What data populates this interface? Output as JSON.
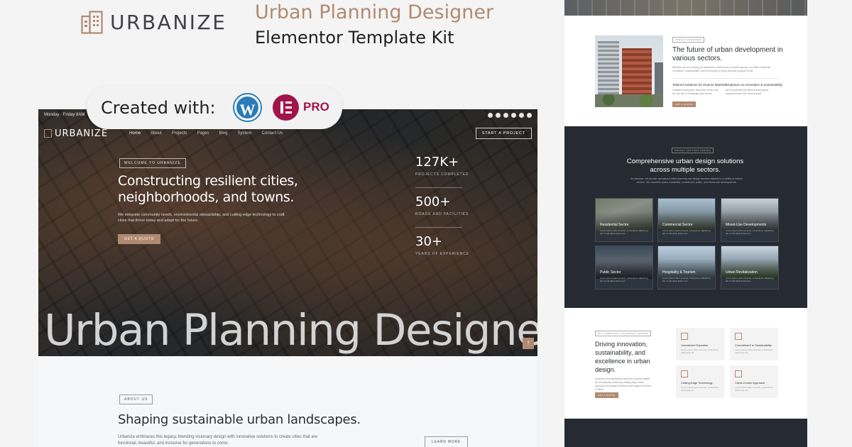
{
  "brand": {
    "logo_text": "URBANIZE",
    "title": "Urban Planning Designer",
    "subtitle": "Elementor Template Kit"
  },
  "badge": {
    "created_with": "Created with:",
    "wordpress_glyph": "W",
    "pro_label": "PRO",
    "icons": [
      "wordpress-icon",
      "elementor-icon"
    ]
  },
  "colors": {
    "accent": "#b08a70",
    "dark": "#262b33",
    "wordpress": "#2b7bb9",
    "elementor": "#a3134b"
  },
  "main": {
    "topbar": {
      "hours": "Monday - Friday 8AM",
      "social_icons": [
        "facebook-icon",
        "youtube-icon",
        "instagram-icon",
        "pinterest-icon",
        "x-icon",
        "linkedin-icon"
      ]
    },
    "nav": {
      "logo": "URBANIZE",
      "links": [
        "Home",
        "About",
        "Projects",
        "Pages",
        "Blog",
        "System",
        "Contact Us"
      ],
      "cta": "START A PROJECT"
    },
    "hero": {
      "tag": "WELCOME TO URBANIZE",
      "heading": "Constructing resilient cities, neighborhoods, and towns.",
      "text": "We integrate community needs, environmental stewardship, and cutting-edge technology to craft cities that thrive today and adapt for the future.",
      "button": "GET A QUOTE",
      "stats": [
        {
          "value": "127K+",
          "label": "PROJECTS COMPLETED"
        },
        {
          "value": "500+",
          "label": "ROADS AND FACILITIES"
        },
        {
          "value": "30+",
          "label": "YEARS OF EXPERIENCE"
        }
      ],
      "big_title": "Urban Planning Designer.",
      "scroll_glyph": "↑"
    },
    "about": {
      "tag": "ABOUT US",
      "heading": "Shaping sustainable urban landscapes.",
      "text": "Urbanize embraces this legacy, blending visionary design with innovative solutions to create cities that are functional, beautiful, and inclusive for generations to come.",
      "button": "LEARN MORE"
    }
  },
  "right": {
    "overview": {
      "tag": "INSIGHT OVERVIEW",
      "heading": "The future of urban development in various sectors.",
      "text": "Whether we are working on residential, commercial, or public spaces, our team combines innovation, sustainability, and technology to bring visionary projects to life.",
      "points": [
        {
          "title": "Tailored Solutions for Diverse Markets",
          "text": "Urbanize recognizes that each sector has its own set of challenges and needs."
        },
        {
          "title": "Emphasis on Innovation & Sustainability",
          "text": "We incorporate the latest technological advancements into every project."
        }
      ],
      "button": "GET A QUOTE"
    },
    "sectors": {
      "tag": "MARKET SECTORS SERVED",
      "heading": "Comprehensive urban design solutions across multiple sectors.",
      "text": "At Urbanize, we provide specialized urban planning and design services tailored to a variety of market sectors. Our expertise spans residential, commercial, public, and mixed-use developments.",
      "cards": [
        {
          "title": "Residential Sector",
          "text": "Lorem ipsum dolor sit amet, consectetur adipiscing elit. Ut elit tellus luctus nec."
        },
        {
          "title": "Commercial Sector",
          "text": "Lorem ipsum dolor sit amet, consectetur adipiscing elit. Ut elit tellus luctus nec."
        },
        {
          "title": "Mixed-Use Developments",
          "text": "Lorem ipsum dolor sit amet, consectetur adipiscing elit. Ut elit tellus luctus nec."
        },
        {
          "title": "Public Sector",
          "text": "Lorem ipsum dolor sit amet, consectetur adipiscing elit. Ut elit tellus luctus nec."
        },
        {
          "title": "Hospitality & Tourism",
          "text": "Lorem ipsum dolor sit amet, consectetur adipiscing elit. Ut elit tellus luctus nec."
        },
        {
          "title": "Urban Revitalization",
          "text": "Lorem ipsum dolor sit amet, consectetur adipiscing elit. Ut elit tellus luctus nec."
        }
      ]
    },
    "why": {
      "tag": "WHY URBANIZE IS A MARKET LEADER",
      "heading": "Driving innovation, sustainability, and excellence in urban design.",
      "text": "Urbanize has established itself as a market leader by consistently delivering cutting-edge urban planning and design solutions that shape the future of cities.",
      "button": "GET A QUOTE",
      "features": [
        {
          "title": "Unmatched Expertise",
          "text": "Lorem ipsum dolor sit amet, consectetur adipiscing elit."
        },
        {
          "title": "Commitment to Sustainability",
          "text": "Lorem ipsum dolor sit amet, consectetur adipiscing elit."
        },
        {
          "title": "Cutting-Edge Technology",
          "text": "Lorem ipsum dolor sit amet, consectetur adipiscing elit."
        },
        {
          "title": "Client-Centric Approach",
          "text": "Lorem ipsum dolor sit amet, consectetur adipiscing elit."
        }
      ]
    }
  }
}
